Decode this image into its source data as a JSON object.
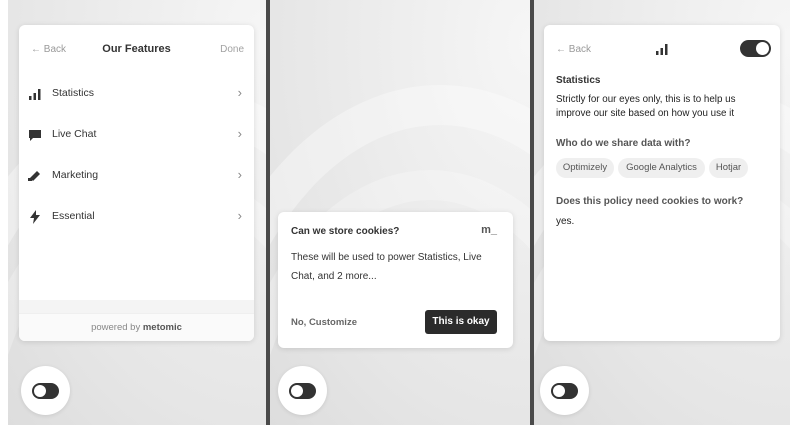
{
  "features_screen": {
    "back_label": "← Back",
    "title": "Our Features",
    "done_label": "Done",
    "items": [
      {
        "label": "Statistics",
        "icon": "bar-chart-icon"
      },
      {
        "label": "Live Chat",
        "icon": "chat-bubble-icon"
      },
      {
        "label": "Marketing",
        "icon": "megaphone-icon"
      },
      {
        "label": "Essential",
        "icon": "lightning-icon"
      }
    ],
    "footer_prefix": "powered by",
    "footer_brand": "metomic"
  },
  "consent_banner": {
    "question": "Can we store cookies?",
    "logo": "m_",
    "body": "These will be used to power Statistics, Live Chat, and 2 more...",
    "secondary_action": "No, Customize",
    "primary_action": "This is okay"
  },
  "detail_screen": {
    "back_label": "← Back",
    "toggle_on": true,
    "title": "Statistics",
    "description": "Strictly for our eyes only, this is to help us improve our site based on how you use it",
    "share_heading": "Who do we share data with?",
    "partners": [
      "Optimizely",
      "Google Analytics",
      "Hotjar"
    ],
    "policy_question": "Does this policy need cookies to work?",
    "policy_answer": "yes."
  },
  "colors": {
    "dark": "#2b2b2b",
    "chip": "#efefef",
    "muted": "#9a9a9a"
  }
}
